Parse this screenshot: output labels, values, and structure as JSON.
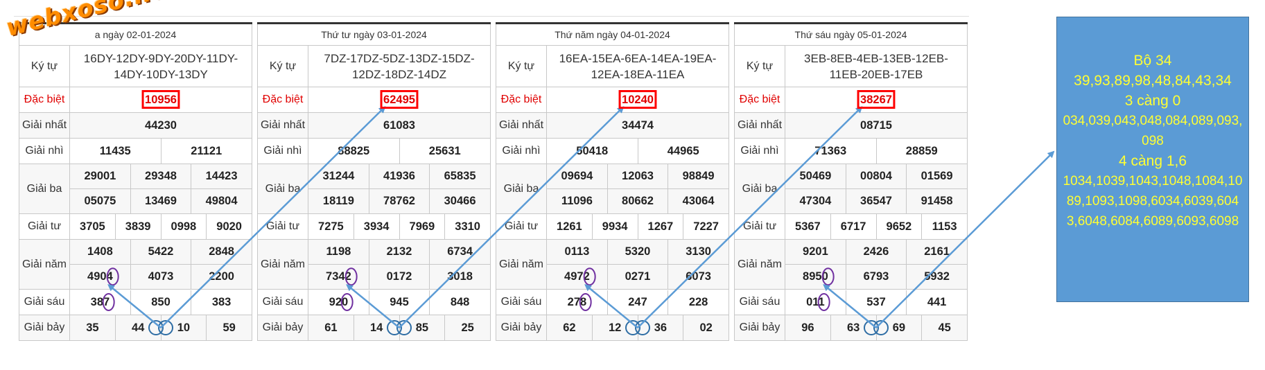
{
  "logo": "webxoso.net",
  "labels": {
    "ky_tu": "Ký tự",
    "dac_biet": "Đặc biệt",
    "giai_nhat": "Giải nhất",
    "giai_nhi": "Giải nhì",
    "giai_ba": "Giải ba",
    "giai_tu": "Giải tư",
    "giai_nam": "Giải năm",
    "giai_sau": "Giải sáu",
    "giai_bay": "Giải bảy"
  },
  "tickets": [
    {
      "header": "a ngày 02-01-2024",
      "ky_tu_line1": "16DY-12DY-9DY-20DY-11DY-",
      "ky_tu_line2": "14DY-10DY-13DY",
      "dac_biet": "10956",
      "giai_nhat": "44230",
      "giai_nhi": [
        "11435",
        "21121"
      ],
      "giai_ba": [
        "29001",
        "29348",
        "14423",
        "05075",
        "13469",
        "49804"
      ],
      "giai_tu": [
        "3705",
        "3839",
        "0998",
        "9020"
      ],
      "giai_nam": [
        "1408",
        "5422",
        "2848",
        "4904",
        "4073",
        "2200"
      ],
      "giai_sau": [
        "387",
        "850",
        "383"
      ],
      "giai_bay": [
        "35",
        "44",
        "10",
        "59"
      ]
    },
    {
      "header": "Thứ tư ngày 03-01-2024",
      "ky_tu_line1": "7DZ-17DZ-5DZ-13DZ-15DZ-",
      "ky_tu_line2": "12DZ-18DZ-14DZ",
      "dac_biet": "62495",
      "giai_nhat": "61083",
      "giai_nhi": [
        "88825",
        "25631"
      ],
      "giai_ba": [
        "31244",
        "41936",
        "65835",
        "18119",
        "78762",
        "30466"
      ],
      "giai_tu": [
        "7275",
        "3934",
        "7969",
        "3310"
      ],
      "giai_nam": [
        "1198",
        "2132",
        "6734",
        "7342",
        "0172",
        "3018"
      ],
      "giai_sau": [
        "920",
        "945",
        "848"
      ],
      "giai_bay": [
        "61",
        "14",
        "85",
        "25"
      ]
    },
    {
      "header": "Thứ năm ngày 04-01-2024",
      "ky_tu_line1": "16EA-15EA-6EA-14EA-19EA-",
      "ky_tu_line2": "12EA-18EA-11EA",
      "dac_biet": "10240",
      "giai_nhat": "34474",
      "giai_nhi": [
        "50418",
        "44965"
      ],
      "giai_ba": [
        "09694",
        "12063",
        "98849",
        "11096",
        "80662",
        "43064"
      ],
      "giai_tu": [
        "1261",
        "9934",
        "1267",
        "7227"
      ],
      "giai_nam": [
        "0113",
        "5320",
        "3130",
        "4972",
        "0271",
        "6073"
      ],
      "giai_sau": [
        "278",
        "247",
        "228"
      ],
      "giai_bay": [
        "62",
        "12",
        "36",
        "02"
      ]
    },
    {
      "header": "Thứ sáu ngày 05-01-2024",
      "ky_tu_line1": "3EB-8EB-4EB-13EB-12EB-",
      "ky_tu_line2": "11EB-20EB-17EB",
      "dac_biet": "38267",
      "giai_nhat": "08715",
      "giai_nhi": [
        "71363",
        "28859"
      ],
      "giai_ba": [
        "50469",
        "00804",
        "01569",
        "47304",
        "36547",
        "91458"
      ],
      "giai_tu": [
        "5367",
        "6717",
        "9652",
        "1153"
      ],
      "giai_nam": [
        "9201",
        "2426",
        "2161",
        "8950",
        "6793",
        "5932"
      ],
      "giai_sau": [
        "011",
        "537",
        "441"
      ],
      "giai_bay": [
        "96",
        "63",
        "69",
        "45"
      ]
    }
  ],
  "infobox": {
    "line1": "Bộ 34",
    "line2": "39,93,89,98,48,84,43,34",
    "line3": "3 càng 0",
    "line4": "034,039,043,048,084,089,093,098",
    "line5": "4 càng 1,6",
    "line6": "1034,1039,1043,1048,1084,1089,1093,1098,6034,6039,6043,6048,6084,6089,6093,6098"
  },
  "colors": {
    "arrow": "#5b9bd5",
    "purple_circle": "#7030a0",
    "red_box": "#ff0000",
    "infobox_bg": "#5b9bd5",
    "infobox_text": "#ffff33"
  }
}
